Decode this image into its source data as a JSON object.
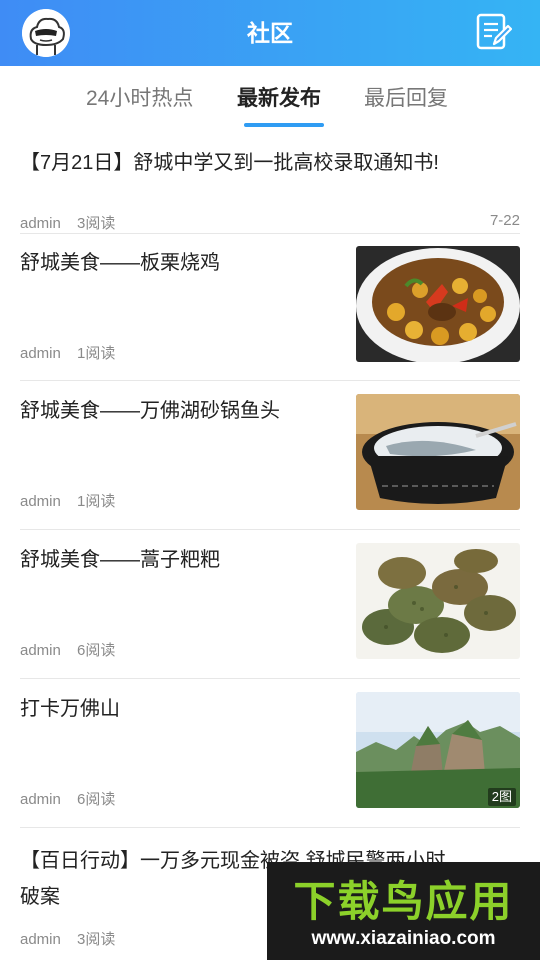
{
  "header": {
    "title": "社区",
    "avatar_icon": "cloud-mascot-avatar",
    "compose_icon": "edit-note-icon",
    "gradient": [
      "#3f8cf5",
      "#35b4f4"
    ]
  },
  "tabs": [
    {
      "label": "24小时热点",
      "active": false
    },
    {
      "label": "最新发布",
      "active": true
    },
    {
      "label": "最后回复",
      "active": false
    }
  ],
  "accent_color": "#2f9cf3",
  "posts": [
    {
      "title": "【7月21日】舒城中学又到一批高校录取通知书!",
      "author": "admin",
      "reads": "3阅读",
      "date": "7-22"
    },
    {
      "title": "舒城美食——板栗烧鸡",
      "author": "admin",
      "reads": "1阅读",
      "image": "braised-chicken-chestnut-photo"
    },
    {
      "title": "舒城美食——万佛湖砂锅鱼头",
      "author": "admin",
      "reads": "1阅读",
      "image": "fish-head-casserole-photo"
    },
    {
      "title": "舒城美食——蒿子粑粑",
      "author": "admin",
      "reads": "6阅读",
      "image": "wormwood-cakes-photo"
    },
    {
      "title": "打卡万佛山",
      "author": "admin",
      "reads": "6阅读",
      "image": "wanfo-mountain-photo",
      "image_count": "2图"
    },
    {
      "title_line1": "【百日行动】一万多元现金被盗 舒城民警两小时",
      "title_line2": "破案",
      "author": "admin",
      "reads": "3阅读"
    }
  ],
  "watermark": {
    "text": "下载鸟应用",
    "url": "www.xiazainiao.com"
  }
}
